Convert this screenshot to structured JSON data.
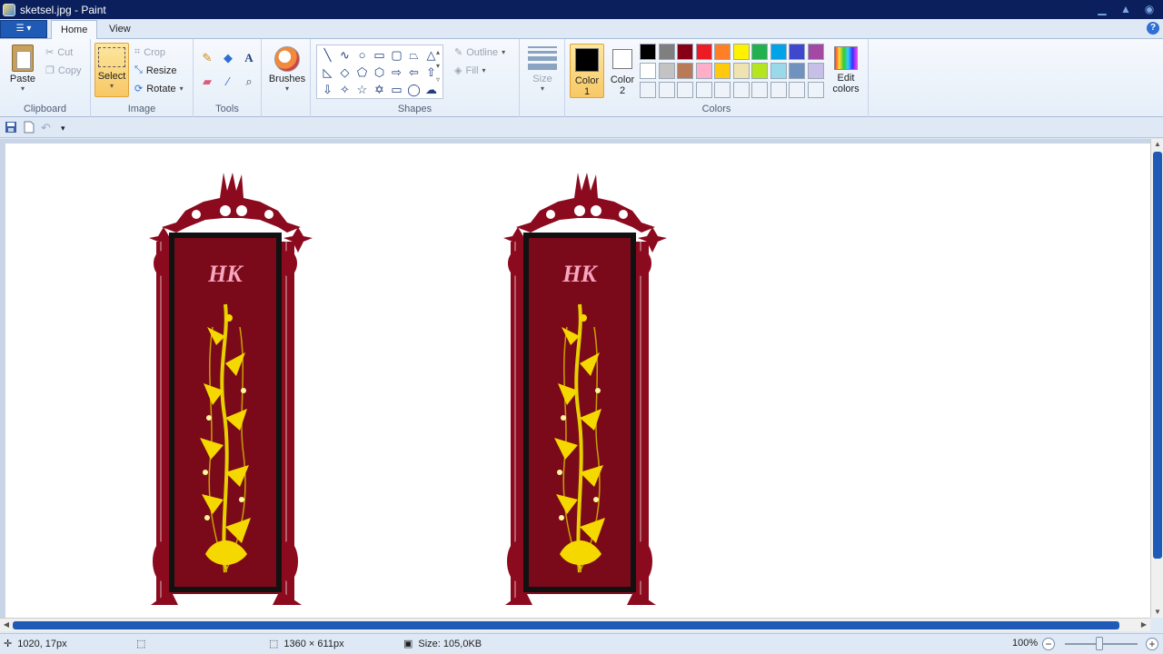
{
  "window": {
    "title": "sketsel.jpg - Paint"
  },
  "tabs": {
    "home": "Home",
    "view": "View"
  },
  "ribbon": {
    "clipboard": {
      "label": "Clipboard",
      "paste": "Paste",
      "cut": "Cut",
      "copy": "Copy"
    },
    "image": {
      "label": "Image",
      "select": "Select",
      "crop": "Crop",
      "resize": "Resize",
      "rotate": "Rotate"
    },
    "tools": {
      "label": "Tools"
    },
    "brushes": {
      "label": "Brushes"
    },
    "shapes": {
      "label": "Shapes",
      "outline": "Outline",
      "fill": "Fill"
    },
    "size": {
      "label": "Size"
    },
    "colors": {
      "label": "Colors",
      "color1": "Color\n1",
      "color1_line1": "Color",
      "color1_line2": "1",
      "color2_line1": "Color",
      "color2_line2": "2",
      "color1_value": "#000000",
      "color2_value": "#ffffff",
      "edit_line1": "Edit",
      "edit_line2": "colors",
      "palette_row1": [
        "#000000",
        "#7f7f7f",
        "#880015",
        "#ed1c24",
        "#ff7f27",
        "#fff200",
        "#22b14c",
        "#00a2e8",
        "#3f48cc",
        "#a349a4"
      ],
      "palette_row2": [
        "#ffffff",
        "#c3c3c3",
        "#b97a57",
        "#ffaec9",
        "#ffc90e",
        "#efe4b0",
        "#b5e61d",
        "#99d9ea",
        "#7092be",
        "#c8bfe7"
      ]
    }
  },
  "status": {
    "cursor": "1020, 17px",
    "selection": "",
    "canvas_size": "1360 × 611px",
    "file_size": "Size: 105,0KB",
    "zoom": "100%"
  },
  "artwork": {
    "panel_logo": "HK",
    "frame_color": "#8b0a1e",
    "panel_color": "#7a0a1a",
    "flower_color": "#f5d800"
  }
}
